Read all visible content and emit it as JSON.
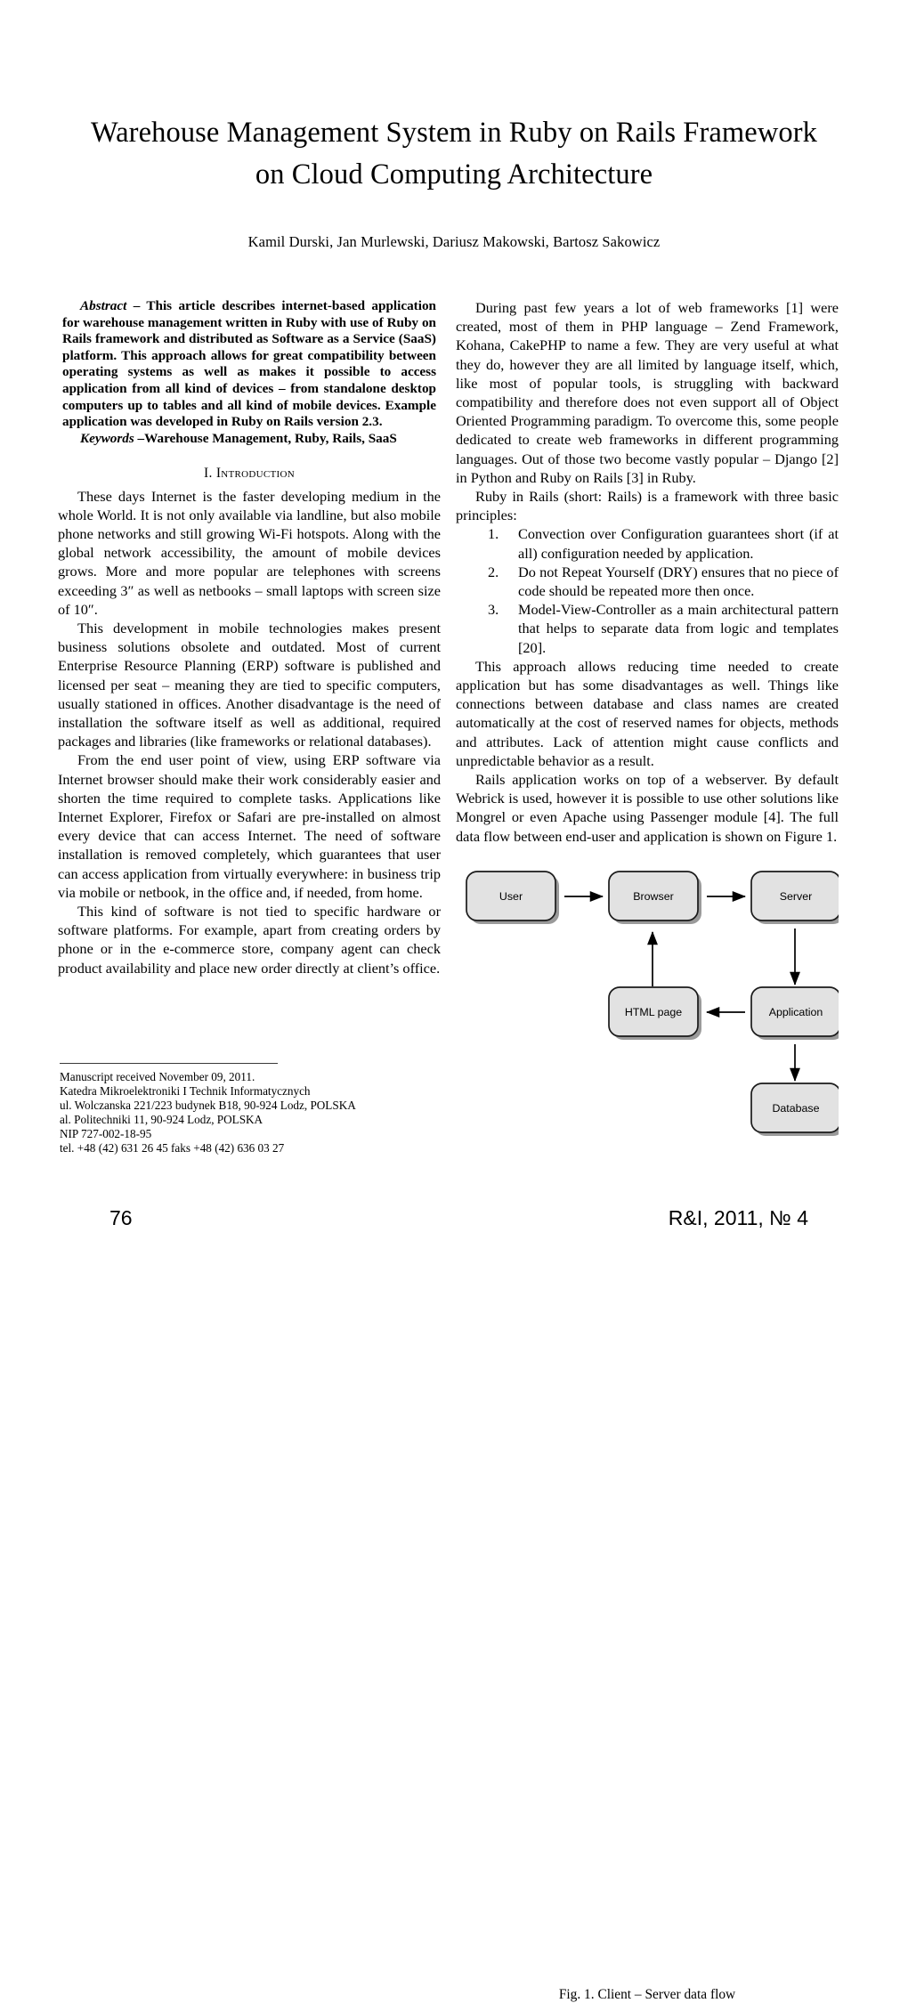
{
  "paper": {
    "title": "Warehouse Management System in Ruby on Rails Framework on Cloud Computing Architecture",
    "authors": "Kamil Durski, Jan Murlewski, Dariusz Makowski, Bartosz Sakowicz"
  },
  "abstract": {
    "label": "Abstract",
    "dash": " – ",
    "text": "This article describes internet-based application for warehouse management written in Ruby with use of Ruby on Rails framework and distributed as Software as a Service (SaaS) platform. This approach allows for great compatibility between operating systems as well as makes it possible to access application from all kind of devices – from standalone desktop computers up to tables and all kind of mobile devices. Example application was developed in Ruby on Rails version 2.3.",
    "keywords_label": "Keywords",
    "keywords_dash": " –",
    "keywords_text": "Warehouse Management, Ruby, Rails, SaaS"
  },
  "sections": {
    "introduction": {
      "number": "I.",
      "title": "Introduction"
    }
  },
  "left_column": {
    "paragraphs": [
      "These days Internet is the faster developing medium in the whole World. It is not only available via landline, but also mobile phone networks and still growing Wi-Fi hotspots. Along with the global network accessibility, the amount of mobile devices grows. More and more popular are telephones with screens exceeding 3″ as well as netbooks – small laptops with screen size of 10″.",
      "This development in mobile technologies makes present business solutions obsolete and outdated. Most of current Enterprise Resource Planning (ERP) software is published and licensed per seat – meaning they are tied to specific computers, usually stationed in offices. Another disadvantage is the need of installation the software itself as well as additional, required packages and libraries (like frameworks or relational databases).",
      "From the end user point of view, using ERP software via Internet browser should make their work considerably easier and shorten the time required to complete tasks. Applications like Internet Explorer, Firefox or Safari are pre-installed on almost every device that can access Internet. The need of software installation is removed completely, which guarantees that user can access application from virtually everywhere: in business trip via mobile or netbook, in the office and, if needed, from home.",
      "This kind of software is not tied to specific hardware or software platforms. For example, apart from creating orders by phone or in the e-commerce store, company agent can check product availability and place new order directly at client’s office."
    ]
  },
  "right_column": {
    "paragraph_1": "During past few years a lot of web frameworks [1] were created, most of them in PHP language – Zend Framework, Kohana, CakePHP to name a few. They are very useful at what they do, however they are all limited by language itself, which, like most of popular tools, is struggling with backward compatibility and therefore does not even support all of Object Oriented Programming paradigm. To overcome this, some people dedicated to create web frameworks in different programming languages. Out of those two become vastly popular – Django [2] in Python and Ruby on Rails [3] in Ruby.",
    "paragraph_2": "Ruby in Rails (short: Rails) is a framework with three basic principles:",
    "principles": [
      {
        "num": "1.",
        "text": "Convection over Configuration guarantees short (if at all) configuration needed by application."
      },
      {
        "num": "2.",
        "text": "Do not Repeat Yourself (DRY) ensures that no piece of code should be repeated more then once."
      },
      {
        "num": "3.",
        "text": "Model-View-Controller as a main architectural pattern that helps to separate data from logic and templates [20]."
      }
    ],
    "paragraph_3": "This approach allows reducing time needed to create application but has some disadvantages as well. Things like connections between database and class names are created automatically at the cost of reserved names for objects, methods and attributes. Lack of attention might cause conflicts and unpredictable behavior as a result.",
    "paragraph_4": "Rails application works on top of a webserver. By default Webrick is used, however it is possible to use other solutions like Mongrel or even Apache using Passenger module [4]. The full data flow between end-user and application is shown on Figure 1."
  },
  "figure": {
    "caption": "Fig.  1. Client – Server data flow",
    "box_fill": "#e2e2e2",
    "box_stroke": "#1a1a1a",
    "nodes": {
      "user": "User",
      "browser": "Browser",
      "server": "Server",
      "html_page": "HTML page",
      "application": "Application",
      "database": "Database"
    }
  },
  "footnote": {
    "lines": [
      "Manuscript received November 09, 2011.",
      "Katedra Mikroelektroniki I Technik Informatycznych",
      "ul. Wolczanska 221/223 budynek B18, 90-924 Lodz, POLSKA",
      "al. Politechniki 11, 90-924 Lodz, POLSKA",
      "NIP 727-002-18-95",
      "tel. +48 (42) 631 26 45 faks +48 (42) 636 03 27"
    ]
  },
  "footer": {
    "page_number": "76",
    "journal": "R&I, 2011, № 4"
  }
}
